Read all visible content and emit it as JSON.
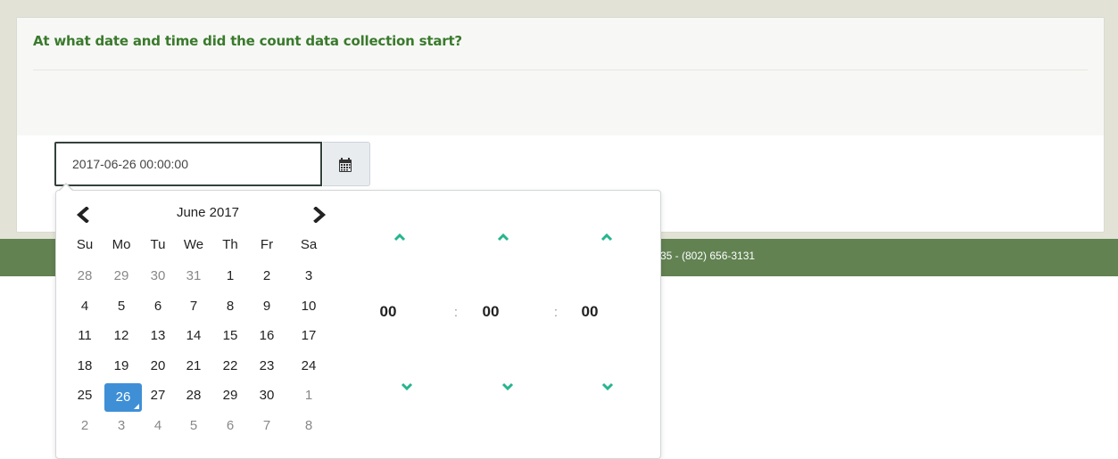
{
  "question": "At what date and time did the count data collection start?",
  "date_input": {
    "value": "2017-06-26 00:00:00"
  },
  "footer": {
    "text": "35 - (802) 656-3131"
  },
  "calendar_button": {
    "icon": "calendar-icon"
  },
  "datepicker": {
    "month_label": "June 2017",
    "prev_icon": "chevron-left-icon",
    "next_icon": "chevron-right-icon",
    "weekdays": [
      "Su",
      "Mo",
      "Tu",
      "We",
      "Th",
      "Fr",
      "Sa"
    ],
    "weeks": [
      [
        {
          "d": "28",
          "muted": true
        },
        {
          "d": "29",
          "muted": true
        },
        {
          "d": "30",
          "muted": true
        },
        {
          "d": "31",
          "muted": true
        },
        {
          "d": "1"
        },
        {
          "d": "2"
        },
        {
          "d": "3"
        }
      ],
      [
        {
          "d": "4"
        },
        {
          "d": "5"
        },
        {
          "d": "6"
        },
        {
          "d": "7"
        },
        {
          "d": "8"
        },
        {
          "d": "9"
        },
        {
          "d": "10"
        }
      ],
      [
        {
          "d": "11"
        },
        {
          "d": "12"
        },
        {
          "d": "13"
        },
        {
          "d": "14"
        },
        {
          "d": "15"
        },
        {
          "d": "16"
        },
        {
          "d": "17"
        }
      ],
      [
        {
          "d": "18"
        },
        {
          "d": "19"
        },
        {
          "d": "20"
        },
        {
          "d": "21"
        },
        {
          "d": "22"
        },
        {
          "d": "23"
        },
        {
          "d": "24"
        }
      ],
      [
        {
          "d": "25"
        },
        {
          "d": "26",
          "active": true
        },
        {
          "d": "27"
        },
        {
          "d": "28"
        },
        {
          "d": "29"
        },
        {
          "d": "30"
        },
        {
          "d": "1",
          "muted": true
        }
      ],
      [
        {
          "d": "2",
          "muted": true
        },
        {
          "d": "3",
          "muted": true
        },
        {
          "d": "4",
          "muted": true
        },
        {
          "d": "5",
          "muted": true
        },
        {
          "d": "6",
          "muted": true
        },
        {
          "d": "7",
          "muted": true
        },
        {
          "d": "8",
          "muted": true
        }
      ]
    ]
  },
  "timepicker": {
    "hours": "00",
    "minutes": "00",
    "seconds": "00",
    "separator": ":",
    "up_icon": "chevron-up-icon",
    "down_icon": "chevron-down-icon"
  },
  "colors": {
    "question_green": "#3a7a2c",
    "footer_green": "#628252",
    "band_beige": "#e2e3d6",
    "accent_teal": "#26b58e",
    "selected_blue": "#3f8fd6"
  }
}
